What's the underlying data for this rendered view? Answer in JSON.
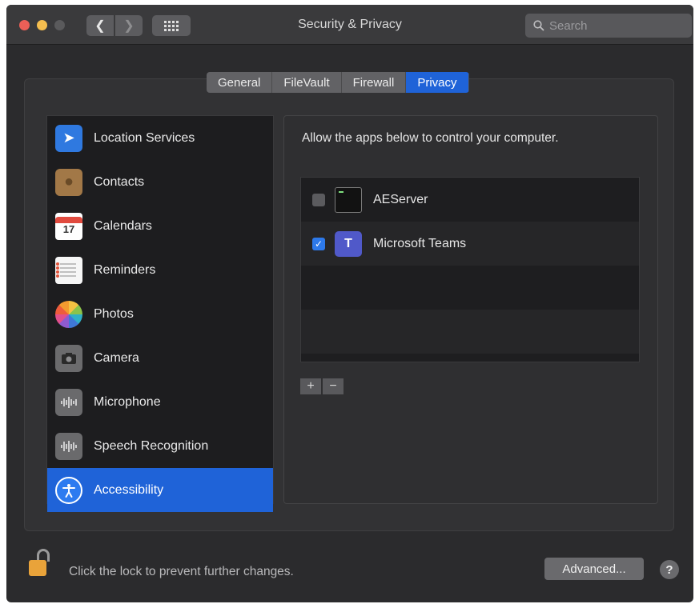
{
  "window": {
    "title": "Security & Privacy",
    "back_icon": "chevron-left-icon",
    "forward_icon": "chevron-right-icon",
    "grid_icon": "show-all-grid-icon"
  },
  "search": {
    "placeholder": "Search",
    "value": ""
  },
  "tabs": [
    {
      "label": "General",
      "active": false
    },
    {
      "label": "FileVault",
      "active": false
    },
    {
      "label": "Firewall",
      "active": false
    },
    {
      "label": "Privacy",
      "active": true
    }
  ],
  "sidebar": {
    "items": [
      {
        "label": "Location Services",
        "icon": "location-arrow-icon",
        "selected": false
      },
      {
        "label": "Contacts",
        "icon": "contacts-book-icon",
        "selected": false
      },
      {
        "label": "Calendars",
        "icon": "calendar-icon",
        "icon_text": "17",
        "selected": false
      },
      {
        "label": "Reminders",
        "icon": "reminders-list-icon",
        "selected": false
      },
      {
        "label": "Photos",
        "icon": "photos-flower-icon",
        "selected": false
      },
      {
        "label": "Camera",
        "icon": "camera-icon",
        "selected": false
      },
      {
        "label": "Microphone",
        "icon": "microphone-waveform-icon",
        "selected": false
      },
      {
        "label": "Speech Recognition",
        "icon": "speech-waveform-icon",
        "selected": false
      },
      {
        "label": "Accessibility",
        "icon": "accessibility-person-icon",
        "selected": true
      }
    ]
  },
  "panel": {
    "message": "Allow the apps below to control your computer.",
    "apps": [
      {
        "name": "AEServer",
        "checked": false,
        "icon": "terminal-app-icon"
      },
      {
        "name": "Microsoft Teams",
        "checked": true,
        "icon": "microsoft-teams-icon"
      }
    ],
    "add_label": "+",
    "remove_label": "−"
  },
  "footer": {
    "lock_text": "Click the lock to prevent further changes.",
    "advanced_label": "Advanced...",
    "help_label": "?"
  },
  "colors": {
    "accent": "#1f63d8",
    "window_bg": "#2b2b2d",
    "list_bg": "#1d1d1f",
    "close": "#ec5f57",
    "minimize": "#f5be4f",
    "lock": "#e9a33a"
  }
}
